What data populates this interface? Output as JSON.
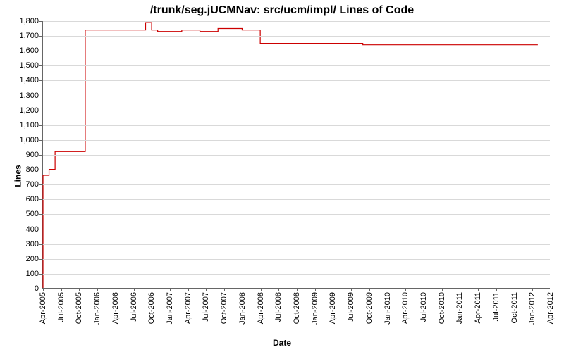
{
  "chart_data": {
    "type": "line",
    "title": "/trunk/seg.jUCMNav: src/ucm/impl/ Lines of Code",
    "xlabel": "Date",
    "ylabel": "Lines",
    "ylim": [
      0,
      1800
    ],
    "y_ticks": [
      0,
      100,
      200,
      300,
      400,
      500,
      600,
      700,
      800,
      900,
      1000,
      1100,
      1200,
      1300,
      1400,
      1500,
      1600,
      1700,
      1800
    ],
    "y_tick_labels": [
      "0",
      "100",
      "200",
      "300",
      "400",
      "500",
      "600",
      "700",
      "800",
      "900",
      "1,000",
      "1,100",
      "1,200",
      "1,300",
      "1,400",
      "1,500",
      "1,600",
      "1,700",
      "1,800"
    ],
    "x_ticks": [
      "Apr-2005",
      "Jul-2005",
      "Oct-2005",
      "Jan-2006",
      "Apr-2006",
      "Jul-2006",
      "Oct-2006",
      "Jan-2007",
      "Apr-2007",
      "Jul-2007",
      "Oct-2007",
      "Jan-2008",
      "Apr-2008",
      "Jul-2008",
      "Oct-2008",
      "Jan-2009",
      "Apr-2009",
      "Jul-2009",
      "Oct-2009",
      "Jan-2010",
      "Apr-2010",
      "Jul-2010",
      "Oct-2010",
      "Jan-2011",
      "Apr-2011",
      "Jul-2011",
      "Oct-2011",
      "Jan-2012",
      "Apr-2012"
    ],
    "series": [
      {
        "name": "Lines of Code",
        "color": "#cc0000",
        "x": [
          "Apr-2005",
          "Apr-2005",
          "May-2005",
          "May-2005",
          "Jun-2005",
          "Jun-2005",
          "Nov-2005",
          "Nov-2005",
          "Sep-2006",
          "Sep-2006",
          "Oct-2006",
          "Oct-2006",
          "Nov-2006",
          "Nov-2006",
          "Mar-2007",
          "Mar-2007",
          "Jun-2007",
          "Jun-2007",
          "Sep-2007",
          "Sep-2007",
          "Jan-2008",
          "Jan-2008",
          "Apr-2008",
          "Apr-2008",
          "Sep-2009",
          "Sep-2009",
          "Feb-2012"
        ],
        "values": [
          0,
          760,
          760,
          800,
          800,
          920,
          920,
          1740,
          1740,
          1790,
          1790,
          1740,
          1740,
          1730,
          1730,
          1740,
          1740,
          1730,
          1730,
          1750,
          1750,
          1740,
          1740,
          1650,
          1650,
          1640,
          1640
        ]
      }
    ]
  }
}
